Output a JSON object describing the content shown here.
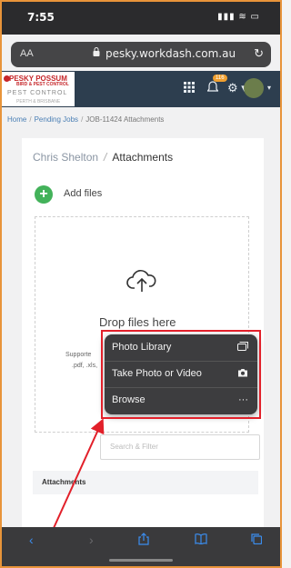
{
  "status_bar": {
    "time": "7:55",
    "indicators": "▮▮▮ ≋ ▭"
  },
  "browser": {
    "text_size_label": "AA",
    "lock_icon": "lock-icon",
    "url": "pesky.workdash.com.au",
    "reload_icon": "reload-icon"
  },
  "app": {
    "logo": {
      "line1": "PESKY POSSUM",
      "line2": "BIRD & PEST CONTROL",
      "line3": "PEST CONTROL",
      "line4": "PERTH & BRISBANE"
    },
    "notification_count": "116",
    "icons": [
      "grid-icon",
      "bell-icon",
      "gear-icon",
      "avatar"
    ]
  },
  "breadcrumb": {
    "home": "Home",
    "pending": "Pending Jobs",
    "current": "JOB-11424 Attachments"
  },
  "page": {
    "title_name": "Chris Shelton",
    "title_section": "Attachments",
    "add_files_label": "Add files",
    "drop_text": "Drop files here",
    "supported_text_1": "Supporte",
    "supported_text_2": ".pdf, .xls,",
    "search_placeholder": "Search & Filter",
    "attachments_header": "Attachments"
  },
  "popup_menu": {
    "items": [
      {
        "label": "Photo Library",
        "icon": "photo-library-icon"
      },
      {
        "label": "Take Photo or Video",
        "icon": "camera-icon"
      },
      {
        "label": "Browse",
        "icon": "more-icon"
      }
    ]
  },
  "colors": {
    "annotation_red": "#e2202a",
    "add_green": "#43b25a",
    "topbar": "#2d3e4f",
    "ios_blue": "#3b8ef0"
  },
  "toolbar_icons": [
    "back-icon",
    "forward-icon",
    "share-icon",
    "bookmarks-icon",
    "tabs-icon"
  ]
}
